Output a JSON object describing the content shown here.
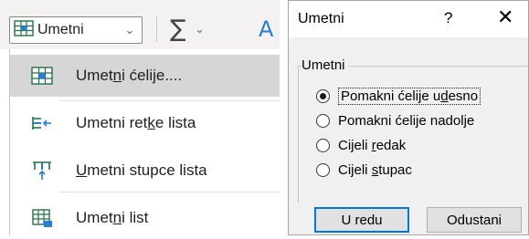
{
  "ribbon": {
    "insert_label": "Umetni",
    "autosum_symbol": "∑",
    "sort_glyph": "A"
  },
  "menu": {
    "items": [
      {
        "pre": "Umet",
        "key": "n",
        "post": "i ćelije....",
        "icon": "insert-cells-icon",
        "highlighted": true
      },
      {
        "pre": "Umetni ret",
        "key": "k",
        "post": "e lista",
        "icon": "insert-rows-icon",
        "highlighted": false
      },
      {
        "pre": "",
        "key": "U",
        "post": "metni stupce lista",
        "icon": "insert-columns-icon",
        "highlighted": false
      },
      {
        "pre": "Umet",
        "key": "n",
        "post": "i list",
        "icon": "insert-sheet-icon",
        "highlighted": false
      }
    ]
  },
  "dialog": {
    "title": "Umetni",
    "help": "?",
    "close": "✕",
    "group_label": "Umetni",
    "options": [
      {
        "pre": "Pomakni ćelije u",
        "key": "d",
        "post": "esno",
        "selected": true
      },
      {
        "pre": "Pomakni ćelije nadol",
        "key": "j",
        "post": "e",
        "selected": false
      },
      {
        "pre": "Cijeli ",
        "key": "r",
        "post": "edak",
        "selected": false
      },
      {
        "pre": "Cijeli ",
        "key": "s",
        "post": "tupac",
        "selected": false
      }
    ],
    "ok_label": "U redu",
    "cancel_label": "Odustani"
  },
  "colors": {
    "accent": "#0078d7",
    "menu_highlight": "#d6d6d6",
    "icon_blue": "#2b7cd3",
    "icon_green": "#217346"
  }
}
